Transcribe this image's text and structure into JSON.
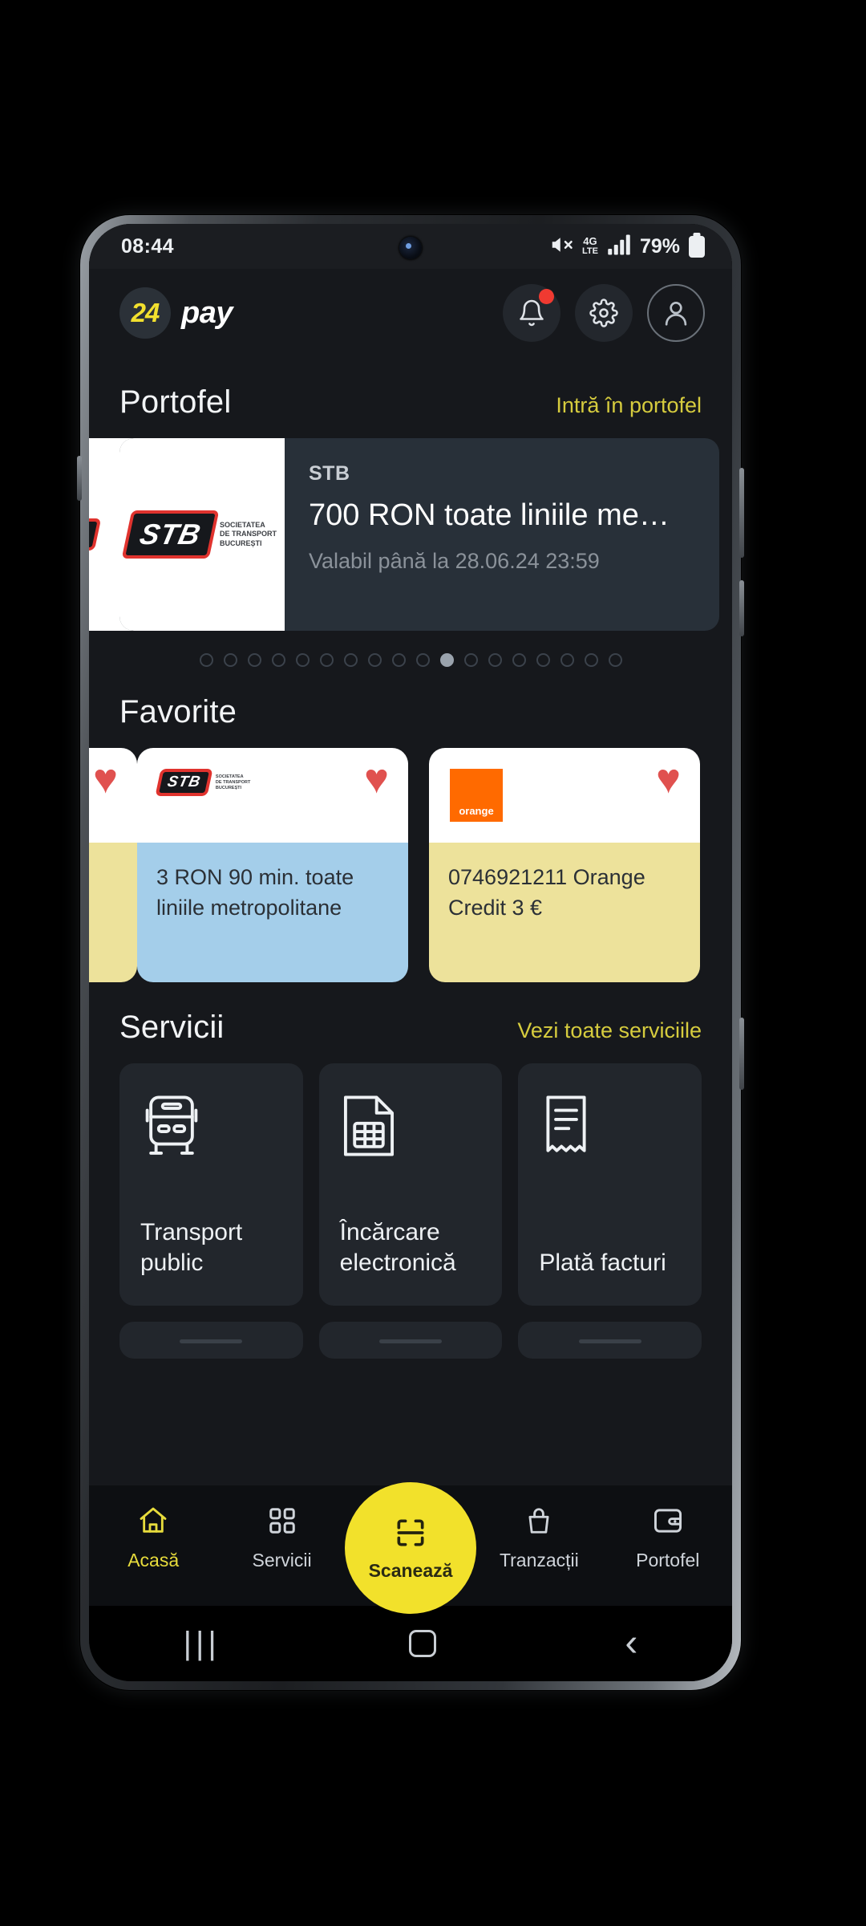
{
  "status_bar": {
    "time": "08:44",
    "network": "4G",
    "battery_percent": "79%",
    "icons": [
      "mute-icon",
      "network-type-icon",
      "signal-bars-icon",
      "battery-icon"
    ]
  },
  "header": {
    "logo_number": "24",
    "logo_word": "pay",
    "actions": [
      {
        "name": "notifications-button",
        "icon": "bell-icon",
        "badge": true
      },
      {
        "name": "settings-button",
        "icon": "gear-icon",
        "badge": false
      },
      {
        "name": "profile-button",
        "icon": "user-icon",
        "badge": false
      }
    ]
  },
  "wallet": {
    "title": "Portofel",
    "link": "Intră în portofel",
    "card": {
      "brand": "STB",
      "title": "700 RON toate liniile me…",
      "validity": "Valabil până la 28.06.24 23:59",
      "logo_text": "STB",
      "logo_subtitle": "SOCIETATEA\nDE TRANSPORT\nBUCUREȘTI"
    },
    "dots_total": 18,
    "dots_active_index": 10
  },
  "favorites": {
    "title": "Favorite",
    "items": [
      {
        "logo": "stb-logo",
        "text": "3 RON 90 min. toate liniile metropolitane",
        "accent": "#A4CEEA",
        "favorited": true
      },
      {
        "logo": "orange-logo",
        "logo_text": "orange",
        "text": "0746921211 Orange Credit 3 €",
        "accent": "#EDE29B",
        "favorited": true
      }
    ]
  },
  "services": {
    "title": "Servicii",
    "link": "Vezi toate serviciile",
    "items": [
      {
        "icon": "bus-icon",
        "label": "Transport public"
      },
      {
        "icon": "sim-card-icon",
        "label": "Încărcare electronică"
      },
      {
        "icon": "receipt-icon",
        "label": "Plată facturi"
      }
    ]
  },
  "bottom_nav": {
    "items": [
      {
        "icon": "home-icon",
        "label": "Acasă",
        "active": true
      },
      {
        "icon": "grid-icon",
        "label": "Servicii",
        "active": false
      },
      {
        "icon": "scan-icon",
        "label": "Scanează",
        "active": false
      },
      {
        "icon": "transactions-icon",
        "label": "Tranzacții",
        "active": false
      },
      {
        "icon": "wallet-icon",
        "label": "Portofel",
        "active": false
      }
    ]
  },
  "android_nav": {
    "recents": "|||",
    "home": "home-square-icon",
    "back": "‹"
  },
  "colors": {
    "brand_yellow": "#F2E12B",
    "link_yellow": "#D6CC3E",
    "background": "#16181c",
    "card": "#22262c",
    "badge_red": "#F03A31"
  }
}
